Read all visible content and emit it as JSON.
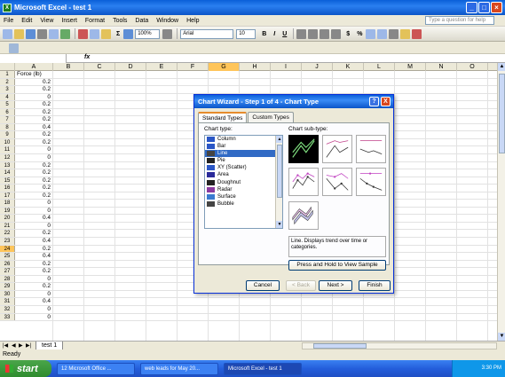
{
  "window": {
    "title": "Microsoft Excel - test 1"
  },
  "menu": [
    "File",
    "Edit",
    "View",
    "Insert",
    "Format",
    "Tools",
    "Data",
    "Window",
    "Help"
  ],
  "help_box": "Type a question for help",
  "toolbar": {
    "zoom": "100%",
    "font": "Arial",
    "font_size": "10",
    "bold": "B",
    "italic": "I",
    "underline": "U",
    "currency": "$",
    "percent": "%"
  },
  "formula": {
    "fx": "fx"
  },
  "columns": [
    "A",
    "B",
    "C",
    "D",
    "E",
    "F",
    "G",
    "H",
    "I",
    "J",
    "K",
    "L",
    "M",
    "N",
    "O"
  ],
  "rows": [
    {
      "n": "1",
      "a": "Force (lb)"
    },
    {
      "n": "2",
      "a": "0.2"
    },
    {
      "n": "3",
      "a": "0.2"
    },
    {
      "n": "4",
      "a": "0"
    },
    {
      "n": "5",
      "a": "0.2"
    },
    {
      "n": "6",
      "a": "0.2"
    },
    {
      "n": "7",
      "a": "0.2"
    },
    {
      "n": "8",
      "a": "0.4"
    },
    {
      "n": "9",
      "a": "0.2"
    },
    {
      "n": "10",
      "a": "0.2"
    },
    {
      "n": "11",
      "a": "0"
    },
    {
      "n": "12",
      "a": "0"
    },
    {
      "n": "13",
      "a": "0.2"
    },
    {
      "n": "14",
      "a": "0.2"
    },
    {
      "n": "15",
      "a": "0.2"
    },
    {
      "n": "16",
      "a": "0.2"
    },
    {
      "n": "17",
      "a": "0.2"
    },
    {
      "n": "18",
      "a": "0"
    },
    {
      "n": "19",
      "a": "0"
    },
    {
      "n": "20",
      "a": "0.4"
    },
    {
      "n": "21",
      "a": "0"
    },
    {
      "n": "22",
      "a": "0.2"
    },
    {
      "n": "23",
      "a": "0.4"
    },
    {
      "n": "24",
      "a": "0.2"
    },
    {
      "n": "25",
      "a": "0.4"
    },
    {
      "n": "26",
      "a": "0.2"
    },
    {
      "n": "27",
      "a": "0.2"
    },
    {
      "n": "28",
      "a": "0"
    },
    {
      "n": "29",
      "a": "0.2"
    },
    {
      "n": "30",
      "a": "0"
    },
    {
      "n": "31",
      "a": "0.4"
    },
    {
      "n": "32",
      "a": "0"
    },
    {
      "n": "33",
      "a": "0"
    }
  ],
  "selected_column": "G",
  "selected_row": "24",
  "sheet_tab": "test 1",
  "status": "Ready",
  "dialog": {
    "title": "Chart Wizard - Step 1 of 4 - Chart Type",
    "tabs": [
      "Standard Types",
      "Custom Types"
    ],
    "chart_type_label": "Chart type:",
    "chart_subtype_label": "Chart sub-type:",
    "chart_types": [
      "Column",
      "Bar",
      "Line",
      "Pie",
      "XY (Scatter)",
      "Area",
      "Doughnut",
      "Radar",
      "Surface",
      "Bubble"
    ],
    "selected_type": "Line",
    "description": "Line. Displays trend over time or categories.",
    "press_button": "Press and Hold to View Sample",
    "buttons": {
      "cancel": "Cancel",
      "back": "< Back",
      "next": "Next >",
      "finish": "Finish"
    },
    "help_btn": "?",
    "close_btn": "X"
  },
  "taskbar": {
    "start": "start",
    "tasks": [
      "12 Microsoft Office ...",
      "web leads for May 20...",
      "Microsoft Excel - test 1"
    ],
    "clock": "3:30 PM"
  }
}
